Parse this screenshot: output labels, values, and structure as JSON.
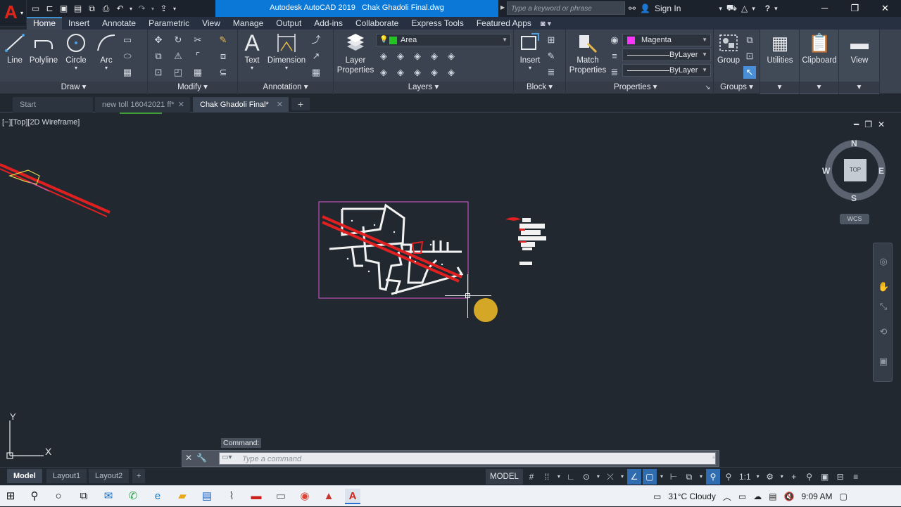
{
  "titlebar": {
    "app_title": "Autodesk AutoCAD 2019",
    "file_title": "Chak Ghadoli Final.dwg",
    "search_placeholder": "Type a keyword or phrase",
    "sign_in": "Sign In",
    "logo_letter": "A"
  },
  "ribbon_tabs": [
    "Home",
    "Insert",
    "Annotate",
    "Parametric",
    "View",
    "Manage",
    "Output",
    "Add-ins",
    "Collaborate",
    "Express Tools",
    "Featured Apps"
  ],
  "ribbon": {
    "draw": {
      "title": "Draw",
      "tools": [
        "Line",
        "Polyline",
        "Circle",
        "Arc"
      ]
    },
    "modify": {
      "title": "Modify"
    },
    "annotation": {
      "title": "Annotation",
      "tools": [
        "Text",
        "Dimension"
      ]
    },
    "layers": {
      "title": "Layers",
      "tool": "Layer Properties",
      "tool_l1": "Layer",
      "tool_l2": "Properties",
      "current_layer": "Area",
      "current_layer_color": "#22c422"
    },
    "block": {
      "title": "Block",
      "tool": "Insert"
    },
    "properties": {
      "title": "Properties",
      "tool_l1": "Match",
      "tool_l2": "Properties",
      "color": "Magenta",
      "color_hex": "#ff33ff",
      "linetype": "ByLayer",
      "lineweight": "ByLayer"
    },
    "groups": {
      "title": "Groups",
      "tool": "Group"
    },
    "utilities": {
      "tool": "Utilities"
    },
    "clipboard": {
      "tool": "Clipboard"
    },
    "view": {
      "tool": "View"
    }
  },
  "doc_tabs": [
    {
      "label": "Start"
    },
    {
      "label": "new toll 16042021 ff*"
    },
    {
      "label": "Chak Ghadoli Final*"
    }
  ],
  "viewport": {
    "label": "[−][Top][2D Wireframe]",
    "compass": {
      "n": "N",
      "s": "S",
      "e": "E",
      "w": "W",
      "cube_face": "TOP"
    },
    "wcs": "WCS",
    "ucs_x": "X",
    "ucs_y": "Y"
  },
  "command": {
    "tooltip": "Command:",
    "placeholder": "Type a command"
  },
  "layout_tabs": [
    "Model",
    "Layout1",
    "Layout2"
  ],
  "status": {
    "model": "MODEL",
    "scale": "1:1"
  },
  "taskbar": {
    "weather": "31°C  Cloudy",
    "time": "9:09 AM"
  }
}
